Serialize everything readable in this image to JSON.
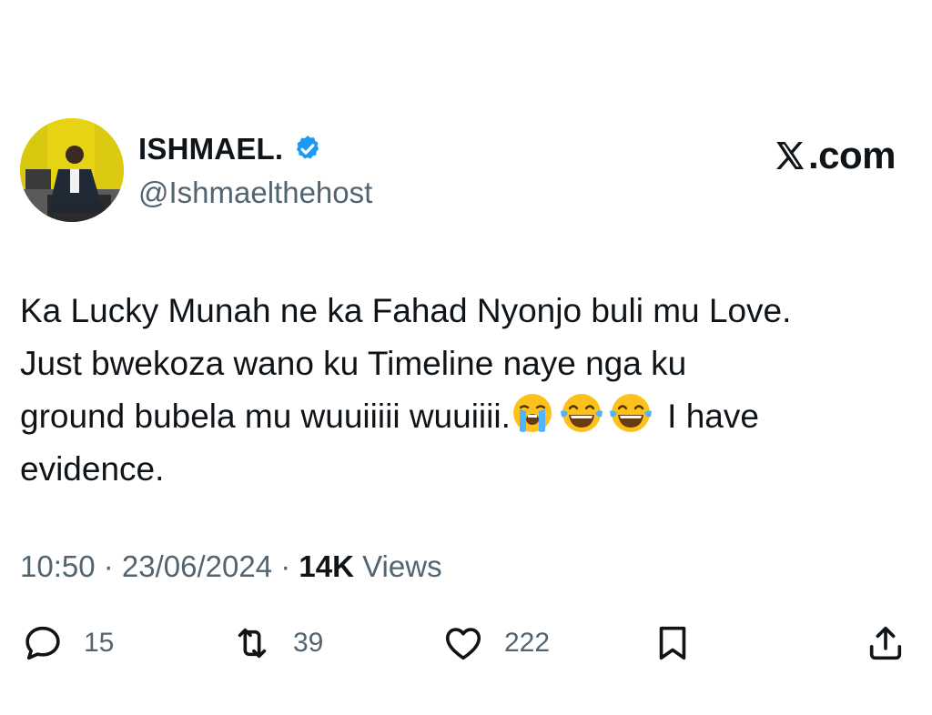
{
  "author": {
    "display_name": "ISHMAEL.",
    "handle": "@Ishmaelthehost",
    "verified": true
  },
  "site_logo": ".com",
  "tweet": {
    "line1": "Ka Lucky Munah ne ka Fahad Nyonjo buli mu Love.",
    "line2": "Just bwekoza wano ku Timeline naye nga ku",
    "line3_start": "ground bubela mu wuuiiiii wuuiiii.",
    "emojis": [
      "loudly-crying-face",
      "face-with-tears-of-joy",
      "face-with-tears-of-joy"
    ],
    "line3_end": " I have",
    "line4": "evidence."
  },
  "meta": {
    "time": "10:50",
    "separator1": " · ",
    "date": "23/06/2024",
    "separator2": " · ",
    "views_count": "14K",
    "views_label": " Views"
  },
  "actions": {
    "reply_count": "15",
    "repost_count": "39",
    "like_count": "222"
  },
  "colors": {
    "text": "#0f1419",
    "secondary": "#536471",
    "verified": "#1d9bf0"
  }
}
